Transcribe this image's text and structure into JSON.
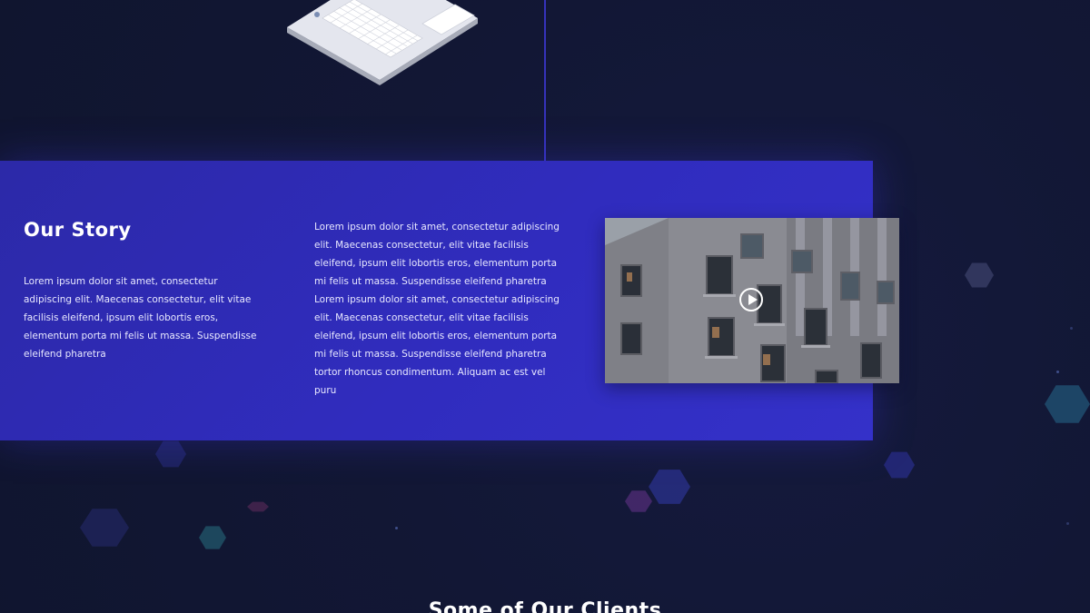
{
  "story": {
    "title": "Our Story",
    "paragraph_1": "Lorem ipsum dolor sit amet, consectetur adipiscing elit. Maecenas consectetur, elit vitae facilisis eleifend, ipsum elit lobortis eros, elementum porta mi felis ut massa. Suspendisse eleifend pharetra",
    "paragraph_2": "Lorem ipsum dolor sit amet, consectetur adipiscing elit. Maecenas consectetur, elit vitae facilisis eleifend, ipsum elit lobortis eros, elementum porta mi felis ut massa. Suspendisse eleifend pharetra Lorem ipsum dolor sit amet, consectetur adipiscing elit. Maecenas consectetur, elit vitae facilisis eleifend, ipsum elit lobortis eros, elementum porta mi felis ut massa. Suspendisse eleifend pharetra tortor rhoncus condimentum. Aliquam ac est vel puru"
  },
  "video": {
    "play_icon": "play-icon"
  },
  "clients": {
    "heading": "Some of Our Clients"
  },
  "colors": {
    "background": "#121735",
    "band": "#302cbe",
    "divider": "#3a35c9",
    "text": "#ffffff"
  }
}
